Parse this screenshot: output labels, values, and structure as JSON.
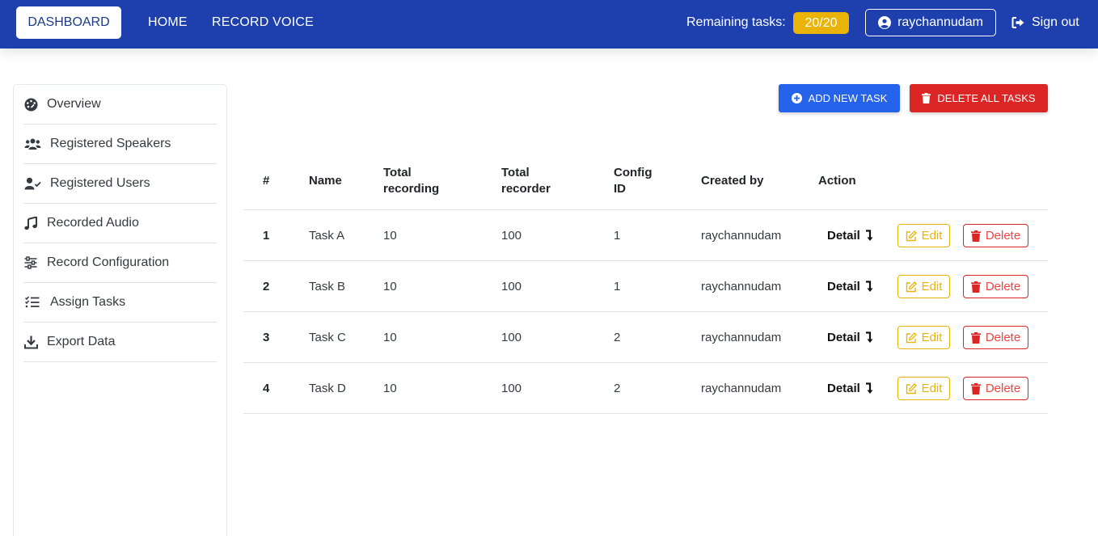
{
  "navbar": {
    "dashboard_label": "DASHBOARD",
    "home_label": "HOME",
    "record_voice_label": "RECORD VOICE",
    "remaining_label": "Remaining tasks:",
    "remaining_value": "20/20",
    "username": "raychannudam",
    "signout_label": "Sign out"
  },
  "sidebar": {
    "items": [
      {
        "label": "Overview",
        "icon": "palette-icon"
      },
      {
        "label": "Registered Speakers",
        "icon": "users-icon"
      },
      {
        "label": "Registered Users",
        "icon": "user-check-icon"
      },
      {
        "label": "Recorded Audio",
        "icon": "music-icon"
      },
      {
        "label": "Record Configuration",
        "icon": "sliders-icon"
      },
      {
        "label": "Assign Tasks",
        "icon": "list-check-icon"
      },
      {
        "label": "Export Data",
        "icon": "download-icon"
      }
    ]
  },
  "toolbar": {
    "add_label": "ADD NEW TASK",
    "delete_all_label": "DELETE ALL TASKS"
  },
  "table": {
    "headers": {
      "num": "#",
      "name": "Name",
      "total_recording_1": "Total",
      "total_recording_2": "recording",
      "total_recorder_1": "Total",
      "total_recorder_2": "recorder",
      "config_1": "Config",
      "config_2": "ID",
      "created_by": "Created by",
      "action": "Action"
    },
    "rows": [
      {
        "num": "1",
        "name": "Task A",
        "total_recording": "10",
        "total_recorder": "100",
        "config_id": "1",
        "created_by": "raychannudam",
        "detail": "Detail",
        "edit": "Edit",
        "delete": "Delete"
      },
      {
        "num": "2",
        "name": "Task B",
        "total_recording": "10",
        "total_recorder": "100",
        "config_id": "1",
        "created_by": "raychannudam",
        "detail": "Detail",
        "edit": "Edit",
        "delete": "Delete"
      },
      {
        "num": "3",
        "name": "Task C",
        "total_recording": "10",
        "total_recorder": "100",
        "config_id": "2",
        "created_by": "raychannudam",
        "detail": "Detail",
        "edit": "Edit",
        "delete": "Delete"
      },
      {
        "num": "4",
        "name": "Task D",
        "total_recording": "10",
        "total_recorder": "100",
        "config_id": "2",
        "created_by": "raychannudam",
        "detail": "Detail",
        "edit": "Edit",
        "delete": "Delete"
      }
    ]
  },
  "colors": {
    "navbar": "#1e40af",
    "badge": "#eab308",
    "primary": "#2563eb",
    "danger": "#dc2626"
  }
}
